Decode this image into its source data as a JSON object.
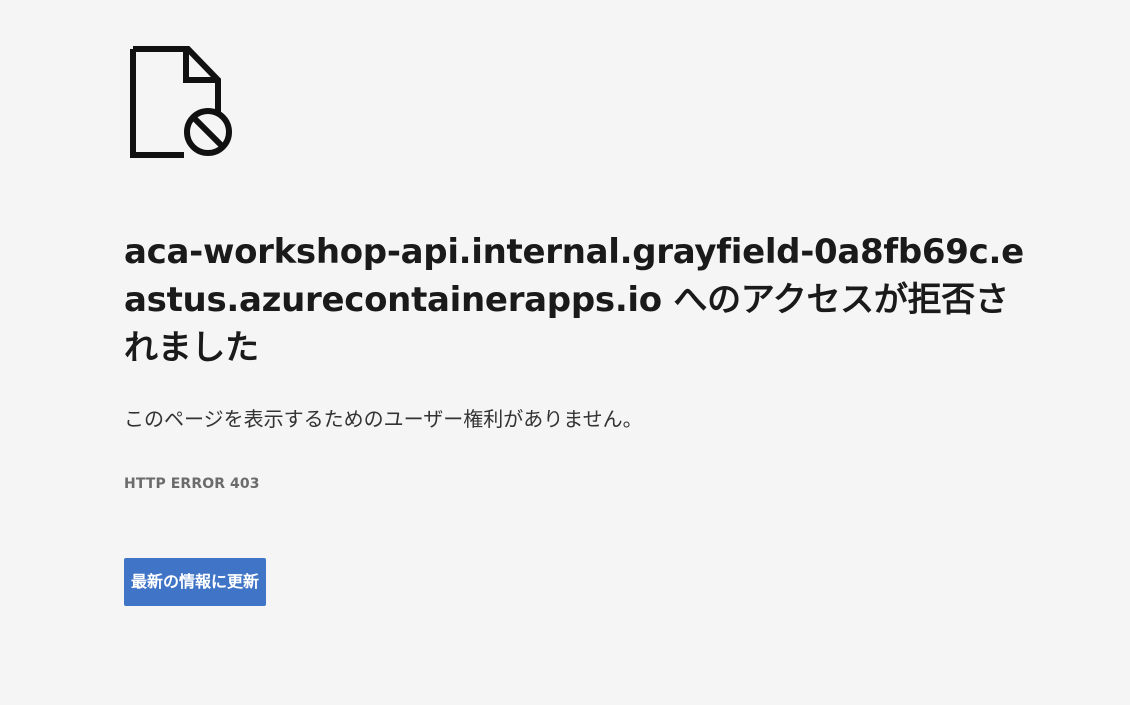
{
  "icon": "document-blocked-icon",
  "title": "aca-workshop-api.internal.grayfield-0a8fb69c.eastus.azurecontainerapps.io へのアクセスが拒否されました",
  "message": "このページを表示するためのユーザー権利がありません。",
  "error_code": "HTTP ERROR 403",
  "reload_button_label": "最新の情報に更新",
  "colors": {
    "background": "#f5f5f5",
    "button": "#3f74c6",
    "text": "#1a1a1a"
  }
}
